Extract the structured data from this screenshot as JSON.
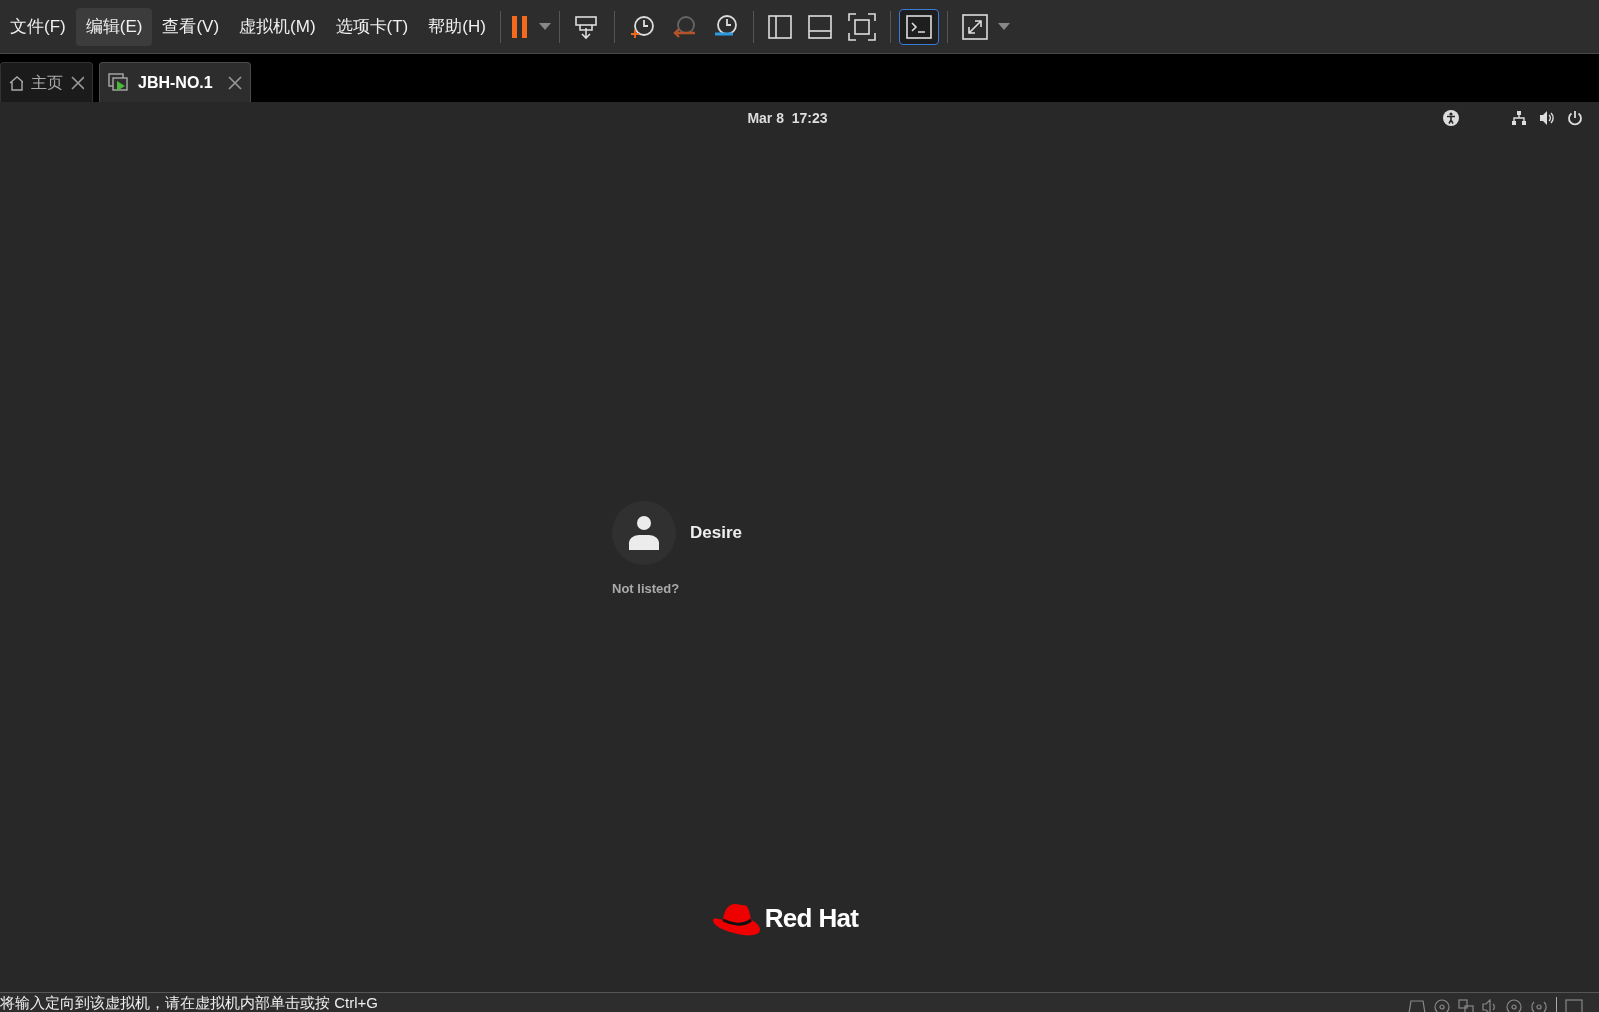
{
  "menu": [
    {
      "label": "文件(F)",
      "selected": false
    },
    {
      "label": "编辑(E)",
      "selected": true
    },
    {
      "label": "查看(V)",
      "selected": false
    },
    {
      "label": "虚拟机(M)",
      "selected": false
    },
    {
      "label": "选项卡(T)",
      "selected": false
    },
    {
      "label": "帮助(H)",
      "selected": false
    }
  ],
  "toolbar": {
    "console_selected": true
  },
  "tabs": [
    {
      "label": "主页",
      "kind": "home",
      "selected": false
    },
    {
      "label": "JBH-NO.1",
      "kind": "vm",
      "selected": true
    }
  ],
  "guest": {
    "clock": "Mar 8  17:23",
    "user": "Desire",
    "not_listed": "Not listed?",
    "logo_text": "Red Hat"
  },
  "status_bar": {
    "message": "将输入定向到该虚拟机，请在虚拟机内部单击或按 Ctrl+G"
  }
}
